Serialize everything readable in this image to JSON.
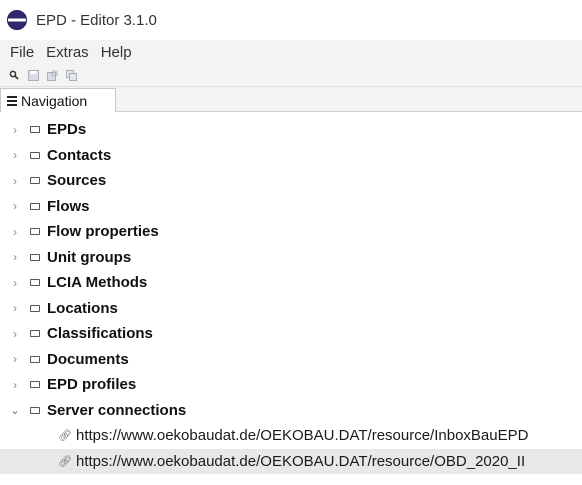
{
  "window": {
    "title": "EPD - Editor 3.1.0"
  },
  "menu": {
    "items": [
      "File",
      "Extras",
      "Help"
    ]
  },
  "tab": {
    "label": "Navigation"
  },
  "tree": {
    "items": [
      "EPDs",
      "Contacts",
      "Sources",
      "Flows",
      "Flow properties",
      "Unit groups",
      "LCIA Methods",
      "Locations",
      "Classifications",
      "Documents",
      "EPD profiles",
      "Server connections"
    ],
    "server_connections": [
      "https://www.oekobaudat.de/OEKOBAU.DAT/resource/InboxBauEPD",
      "https://www.oekobaudat.de/OEKOBAU.DAT/resource/OBD_2020_II"
    ]
  },
  "colors": {
    "app_icon": "#2e2a6c",
    "selected_row": "#e8e8e8",
    "bar_bg": "#f3f3f3"
  }
}
